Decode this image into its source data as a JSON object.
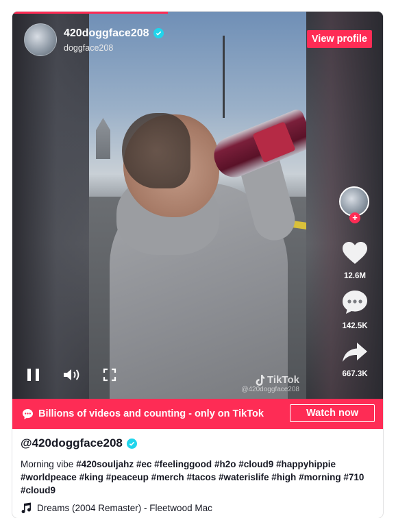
{
  "player": {
    "progress_fraction": 0.42,
    "author": {
      "display_name": "420doggface208",
      "handle": "doggface208",
      "verified": true
    },
    "view_profile_label": "View profile",
    "watermark": {
      "brand": "TikTok",
      "handle": "@420doggface208"
    },
    "side_actions": {
      "likes": "12.6M",
      "comments": "142.5K",
      "shares": "667.3K"
    },
    "icons": [
      "pause-icon",
      "volume-icon",
      "fullscreen-icon",
      "heart-icon",
      "comment-icon",
      "share-icon"
    ]
  },
  "banner": {
    "text": "Billions of videos and counting - only on TikTok",
    "button_label": "Watch now"
  },
  "post": {
    "handle": "@420doggface208",
    "caption_text": "Morning vibe",
    "hashtags": [
      "#420souljahz",
      "#ec",
      "#feelinggood",
      "#h2o",
      "#cloud9",
      "#happyhippie",
      "#worldpeace",
      "#king",
      "#peaceup",
      "#merch",
      "#tacos",
      "#waterislife",
      "#high",
      "#morning",
      "#710",
      "#cloud9"
    ],
    "music": "Dreams (2004 Remaster) - Fleetwood Mac"
  },
  "colors": {
    "accent": "#fe2c55",
    "verified": "#20d5ec",
    "text": "#161823"
  }
}
